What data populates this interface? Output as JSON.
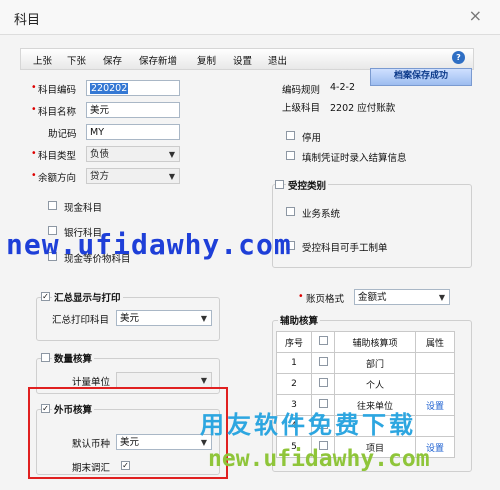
{
  "window": {
    "title": "科目",
    "close": "×"
  },
  "toolbar": {
    "items": [
      "上张",
      "下张",
      "保存",
      "保存新增",
      "复制",
      "设置",
      "退出"
    ],
    "help": "?"
  },
  "status_badge": "档案保存成功",
  "left": {
    "code_label": "科目编码",
    "code_value": "220202",
    "name_label": "科目名称",
    "name_value": "美元",
    "mnemonic_label": "助记码",
    "mnemonic_value": "MY",
    "type_label": "科目类型",
    "type_value": "负债",
    "balance_label": "余额方向",
    "balance_value": "贷方",
    "cash_label": "现金科目",
    "bank_label": "银行科目",
    "equiv_label": "现金等价物科目"
  },
  "right": {
    "rule_label": "编码规则",
    "rule_value": "4-2-2",
    "parent_label": "上级科目",
    "parent_value": "2202 应付账款",
    "disabled_label": "停用",
    "summary_label": "填制凭证时录入结算信息"
  },
  "controlled": {
    "title": "受控类别",
    "business_label": "业务系统",
    "manual_label": "受控科目可手工制单"
  },
  "summary_print": {
    "title": "汇总显示与打印",
    "print_label": "汇总打印科目",
    "print_value": "美元"
  },
  "account_format": {
    "label": "账页格式",
    "value": "金额式"
  },
  "aux": {
    "title": "辅助核算",
    "headers": [
      "序号",
      "",
      "辅助核算项",
      "属性"
    ],
    "rows": [
      {
        "no": "1",
        "item": "部门",
        "attr": ""
      },
      {
        "no": "2",
        "item": "个人",
        "attr": ""
      },
      {
        "no": "3",
        "item": "往来单位",
        "attr": "设置"
      },
      {
        "no": "4",
        "item": "",
        "attr": ""
      },
      {
        "no": "5",
        "item": "项目",
        "attr": "设置"
      }
    ]
  },
  "quantity": {
    "title": "数量核算",
    "unit_label": "计量单位"
  },
  "foreign": {
    "title": "外币核算",
    "currency_label": "默认币种",
    "currency_value": "美元",
    "revalue_label": "期末调汇"
  },
  "watermarks": {
    "url1": "new.ufidawhy.com",
    "cn": "用友软件免费下载",
    "url2": "new.ufidawhy.com"
  }
}
